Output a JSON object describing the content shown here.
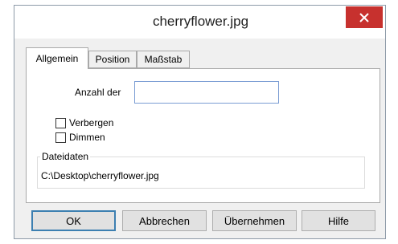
{
  "window": {
    "title": "cherryflower.jpg",
    "close_icon": "close-x-icon",
    "close_color": "#c7312e"
  },
  "tabs": [
    {
      "label": "Allgemein",
      "active": true
    },
    {
      "label": "Position",
      "active": false
    },
    {
      "label": "Maßstab",
      "active": false
    }
  ],
  "general": {
    "count_label": "Anzahl der",
    "count_value": "",
    "hide_label": "Verbergen",
    "hide_checked": false,
    "dim_label": "Dimmen",
    "dim_checked": false,
    "file_group_label": "Dateidaten",
    "file_path": "C:\\Desktop\\cherryflower.jpg"
  },
  "buttons": {
    "ok": "OK",
    "cancel": "Abbrechen",
    "apply": "Übernehmen",
    "help": "Hilfe"
  }
}
